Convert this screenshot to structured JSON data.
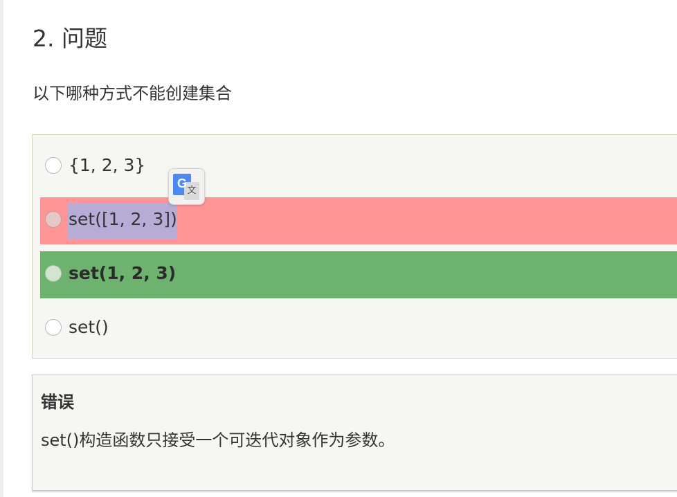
{
  "question": {
    "title": "2. 问题",
    "text": "以下哪种方式不能创建集合"
  },
  "options": [
    {
      "label": "{1, 2, 3}",
      "state": "normal"
    },
    {
      "label": "set([1, 2, 3])",
      "state": "selected-wrong"
    },
    {
      "label": "set(1, 2, 3)",
      "state": "correct"
    },
    {
      "label": "set()",
      "state": "normal"
    }
  ],
  "translate_widget": {
    "icon": "google-translate-icon",
    "g_letter": "G",
    "wen_letter": "文"
  },
  "feedback": {
    "heading": "错误",
    "text": "set()构造函数只接受一个可迭代对象作为参数。"
  },
  "colors": {
    "wrong_bg": "#ff9494",
    "correct_bg": "#6db26f",
    "selection_bg": "#b6acd6",
    "box_bg": "#f6f7f2",
    "box_border": "#c6d8b4"
  }
}
